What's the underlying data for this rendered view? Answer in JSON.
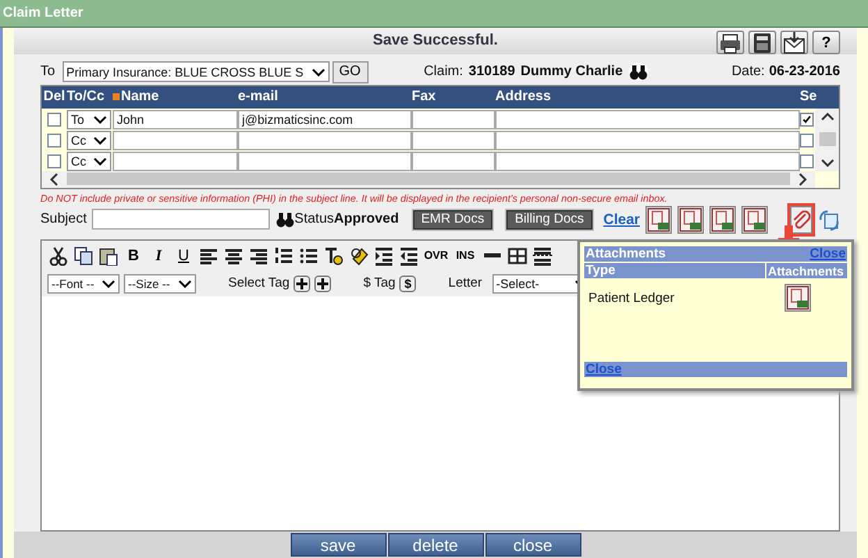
{
  "window": {
    "title": "Claim Letter"
  },
  "header": {
    "message": "Save Successful.",
    "buttons": [
      {
        "kind": "print"
      },
      {
        "kind": "fax"
      },
      {
        "kind": "email"
      },
      {
        "kind": "help",
        "label": "?"
      }
    ]
  },
  "to_row": {
    "label": "To",
    "recipient": "Primary Insurance: BLUE CROSS BLUE S",
    "go": "GO",
    "claim_label": "Claim:",
    "claim_number": "310189",
    "patient": "Dummy Charlie",
    "date_label": "Date:",
    "date": "06-23-2016"
  },
  "recipients": {
    "columns": [
      {
        "label": "Del",
        "required": false
      },
      {
        "label": "To/Cc",
        "required": false
      },
      {
        "label": "Name",
        "required": true
      },
      {
        "label": "e-mail",
        "required": false
      },
      {
        "label": "Fax",
        "required": false
      },
      {
        "label": "Address",
        "required": false
      },
      {
        "label": "Se",
        "required": false
      }
    ],
    "rows": [
      {
        "checked": false,
        "type": "To",
        "name": "John",
        "email": "j@bizmaticsinc.com",
        "column_7_checked": true
      },
      {
        "checked": false,
        "type": "Cc",
        "column_7_checked": false
      },
      {
        "checked": false,
        "type": "Cc",
        "column_7_checked": false
      }
    ]
  },
  "warning": "Do NOT include private or sensitive information (PHI) in the subject line. It will be displayed in the recipient's personal non-secure email inbox.",
  "subject": {
    "label": "Subject",
    "status_label": "Status",
    "status": "Approved",
    "doc_buttons": [
      "EMR Docs",
      "Billing Docs"
    ],
    "clear": "Clear",
    "attach_highlighted": true
  },
  "editor": {
    "format_buttons": [
      "B",
      "I",
      "U"
    ],
    "mode_buttons": [
      "OVR",
      "INS"
    ],
    "font": "--Font --",
    "size": "--Size --",
    "select_tag": "Select Tag",
    "dollar_tag": "$ Tag",
    "dollar_key": "$",
    "letter_label": "Letter",
    "letter": "-Select-"
  },
  "attachments_popup": {
    "title": "Attachments",
    "close": "Close",
    "columns": [
      "Type",
      "Attachments"
    ],
    "rows": [
      {
        "type": "Patient Ledger"
      }
    ],
    "footer": "Close"
  },
  "buttons": [
    "save",
    "delete",
    "close"
  ]
}
